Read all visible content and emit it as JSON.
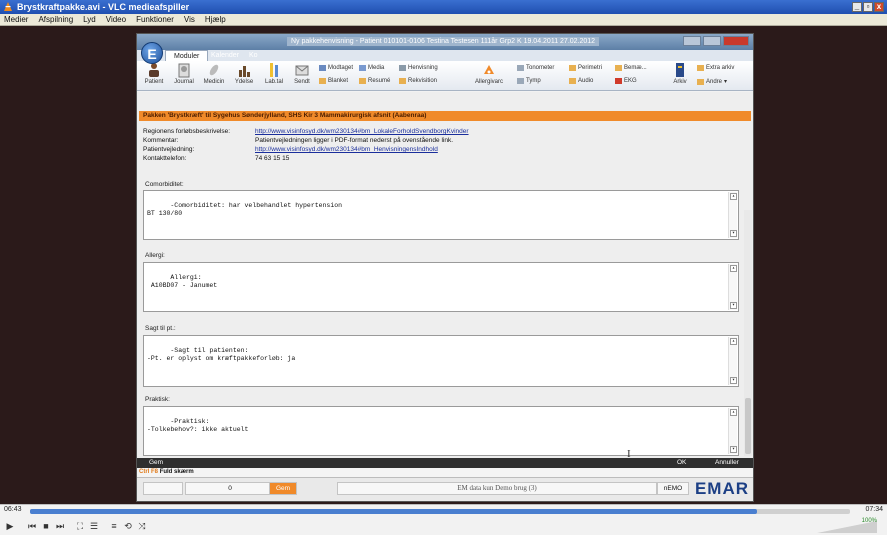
{
  "vlc": {
    "title": "Brystkraftpakke.avi - VLC medieafspiller",
    "menu": [
      "Medier",
      "Afspilning",
      "Lyd",
      "Video",
      "Funktioner",
      "Vis",
      "Hjælp"
    ],
    "time_elapsed": "06:43",
    "time_total": "07:34",
    "progress": 0.887,
    "volume": "100%"
  },
  "emar": {
    "window_title": "Ny pakkehenvisning - Patient 010101-0106 Testina Testesen 111år Grp2 K 19.04.2011 27.02.2012",
    "logo_letter": "E",
    "tabs": [
      "Moduler",
      "Kalender",
      "Ko"
    ],
    "ribbon_large": [
      "Patient",
      "Journal",
      "Medicin",
      "Ydelse",
      "Lab.tal",
      "Sendt",
      "Allergivarc",
      "Arkiv"
    ],
    "ribbon_small": {
      "modtaget": "Modtaget",
      "media": "Media",
      "henvisning": "Henvisning",
      "blanket": "Blanket",
      "resume": "Resumé",
      "rekvisition": "Rekvisition",
      "tonometer": "Tonometer",
      "tymp": "Tymp",
      "perimetri": "Perimetri",
      "audio": "Audio",
      "beskeder": "Bemæ...",
      "ekg": "EKG",
      "extra_arkiv": "Extra arkiv",
      "andre": "Andre"
    },
    "banner": "Pakken 'Brystkræft' til Sygehus Sønderjylland, SHS Kir 3 Mammakirurgisk afsnit (Aabenraa)",
    "info": {
      "forlob_label": "Regionens forløbsbeskrivelse:",
      "forlob_value": "http://www.visinfosyd.dk/wm230134#bm_LokaleForholdSvendborgKvinder",
      "kommentar_label": "Kommentar:",
      "kommentar_value": "Patientvejledningen ligger i PDF-format nederst på ovenstående link.",
      "vejledning_label": "Patientvejledning:",
      "vejledning_value": "http://www.visinfosyd.dk/wm230134#bm_HenvisningensIndhold",
      "kontakt_label": "Kontakttelefon:",
      "kontakt_value": "74 63 15 15"
    },
    "sections": [
      {
        "label": "Comorbiditet:",
        "text": "-Comorbiditet: har velbehandlet hypertension\nBT 130/80"
      },
      {
        "label": "Allergi:",
        "text": "Allergi:\n A10BD07 - Janumet"
      },
      {
        "label": "Sagt til pt.:",
        "text": "-Sagt til patienten:\n-Pt. er oplyst om kræftpakkeforløb: ja"
      },
      {
        "label": "Praktisk:",
        "text": "-Praktisk:\n-Tolkebehov?: ikke aktuelt"
      }
    ],
    "bottom": {
      "gem": "Gem",
      "ok": "OK",
      "annuller": "Annuller"
    },
    "shortcut_key": "Ctrl F8",
    "shortcut_label": "Fuld skærm",
    "status": {
      "num": "0",
      "save": "Gem",
      "demo": "EM data kun Demo brug (3)",
      "user": "nEMO",
      "brand": "EMAR"
    }
  }
}
